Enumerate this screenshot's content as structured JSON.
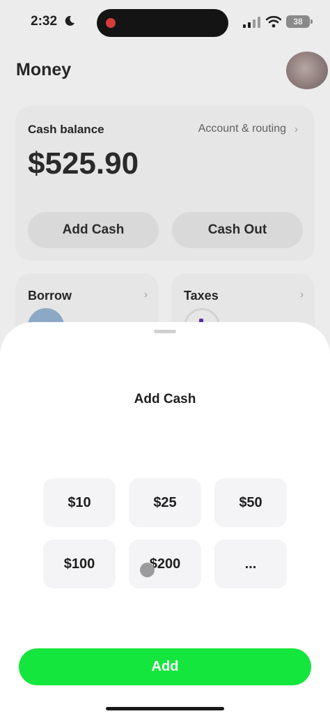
{
  "status_bar": {
    "time": "2:32",
    "battery": "38"
  },
  "header": {
    "title": "Money"
  },
  "balance_card": {
    "label": "Cash balance",
    "account_link": "Account & routing",
    "amount": "$525.90",
    "add_cash_label": "Add Cash",
    "cash_out_label": "Cash Out"
  },
  "cards": {
    "borrow": "Borrow",
    "taxes": "Taxes"
  },
  "sheet": {
    "title": "Add Cash",
    "amounts": [
      "$10",
      "$25",
      "$50",
      "$100",
      "$200",
      "..."
    ],
    "add_label": "Add"
  },
  "icons": {
    "chevron": "chevron-right-icon",
    "moon": "moon-icon",
    "signal": "signal-icon",
    "wifi": "wifi-icon"
  },
  "colors": {
    "accent_green": "#14e63d",
    "recording_red": "#d63b3b"
  }
}
